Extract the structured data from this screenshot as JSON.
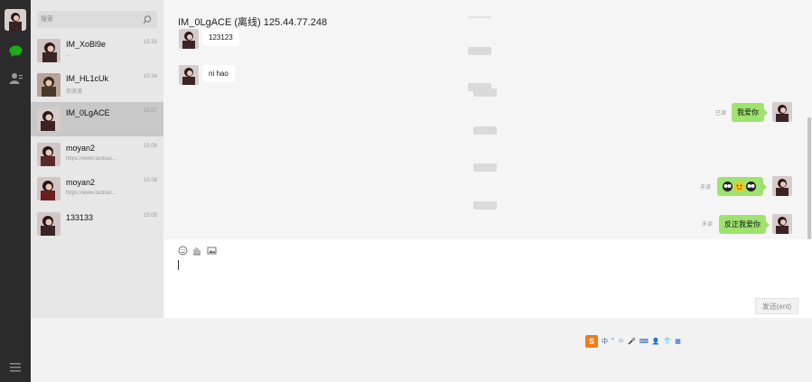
{
  "rail": {
    "icons": [
      "avatar",
      "chat-icon",
      "contacts-icon",
      "menu-icon"
    ]
  },
  "search": {
    "placeholder": "搜索"
  },
  "contacts": [
    {
      "name": "IM_XoBl9e",
      "time": "15:33",
      "preview": "...",
      "selected": false
    },
    {
      "name": "IM_HL1cUk",
      "time": "15:34",
      "preview": "你滚滚",
      "selected": false
    },
    {
      "name": "IM_0LgACE",
      "time": "15:07",
      "preview": "",
      "selected": true
    },
    {
      "name": "moyan2",
      "time": "15:08",
      "preview": "https://www.taobao...",
      "selected": false
    },
    {
      "name": "moyan2",
      "time": "15:08",
      "preview": "https://www.taobao...",
      "selected": false
    },
    {
      "name": "133133",
      "time": "15:05",
      "preview": "",
      "selected": false
    }
  ],
  "chat": {
    "title": "IM_0LgACE (离线) 125.44.77.248",
    "incoming": [
      {
        "text": "123123"
      },
      {
        "text": "ni hao"
      }
    ],
    "outgoing": [
      {
        "status": "已读",
        "text": "我爱你",
        "emoji": false
      },
      {
        "status": "未读",
        "text": "",
        "emoji": true
      },
      {
        "status": "未读",
        "text": "反正我爱你",
        "emoji": false
      }
    ],
    "timestamps": [
      "",
      "",
      "",
      "",
      "",
      ""
    ]
  },
  "compose": {
    "tools": [
      "emoji-icon",
      "hand-icon",
      "image-icon"
    ],
    "send_label": "发送(ent)"
  },
  "ime": {
    "items": [
      "中",
      "°",
      "☺",
      "🎤",
      "⌨",
      "👤",
      "👕",
      "▦"
    ]
  },
  "colors": {
    "rail": "#2b2b2b",
    "contacts_bg": "#e7e7e7",
    "selected": "#c8c8c8",
    "outgoing_bubble": "#9fe36f",
    "chat_bg": "#f5f5f5"
  }
}
